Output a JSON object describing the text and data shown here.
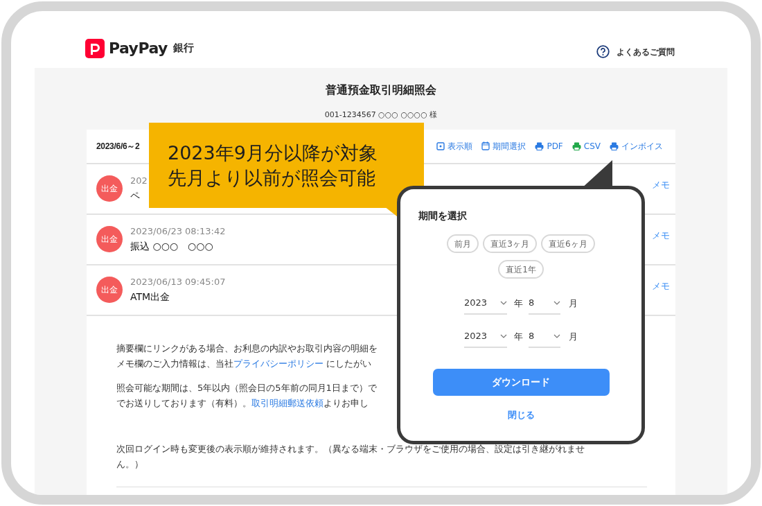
{
  "header": {
    "brand": "PayPay",
    "brand_suffix": "銀行",
    "help_link": "よくあるご質問"
  },
  "page": {
    "title": "普通預金取引明細照会",
    "account": "001-1234567 ○○○ ○○○○ 様"
  },
  "toolbar": {
    "period": "2023/6/6～2",
    "links": [
      {
        "label": "表示順",
        "kind": "sort"
      },
      {
        "label": "期間選択",
        "kind": "calendar"
      },
      {
        "label": "PDF",
        "kind": "print"
      },
      {
        "label": "CSV",
        "kind": "print-green"
      },
      {
        "label": "インボイス",
        "kind": "print"
      }
    ]
  },
  "transactions": [
    {
      "badge": "出金",
      "datetime": "202",
      "description": "ペ",
      "memo": "メモ"
    },
    {
      "badge": "出金",
      "datetime": "2023/06/23 08:13:42",
      "description": "振込 ○○○　○○○",
      "memo": "メモ"
    },
    {
      "badge": "出金",
      "datetime": "2023/06/13 09:45:07",
      "description": "ATM出金",
      "memo": "メモ"
    }
  ],
  "notes": [
    {
      "lines": [
        [
          {
            "kind": "text",
            "text": "摘要欄にリンクがある場合、お利息の内訳やお取引内容の明細を"
          }
        ],
        [
          {
            "kind": "text",
            "text": "メモ欄のご入力情報は、当社"
          },
          {
            "kind": "link",
            "text": "プライバシーポリシー"
          },
          {
            "kind": "text",
            "text": " にしたがい"
          }
        ]
      ]
    },
    {
      "lines": [
        [
          {
            "kind": "text",
            "text": "照会可能な期間は、5年以内（照会日の5年前の同月1日まで）で"
          }
        ],
        [
          {
            "kind": "text",
            "text": "でお送りしております（有料）。"
          },
          {
            "kind": "link",
            "text": "取引明細郵送依頼"
          },
          {
            "kind": "text",
            "text": "よりお申し"
          }
        ]
      ]
    },
    {
      "lines": [
        [
          {
            "kind": "text",
            "text": "次回ログイン時も変更後の表示順が維持されます。（異なる端末・ブラウザをご使用の場合、設定は引き継がれませ"
          }
        ],
        [
          {
            "kind": "text",
            "text": "ん。）"
          }
        ]
      ]
    }
  ],
  "callout": {
    "lines": [
      "2023年9月分以降が対象",
      "先月より以前が照会可能"
    ]
  },
  "popup": {
    "title": "期間を選択",
    "presets": [
      "前月",
      "直近3ヶ月",
      "直近6ヶ月",
      "直近1年"
    ],
    "ranges": [
      {
        "year": "2023",
        "year_unit": "年",
        "month": "8",
        "month_unit": "月"
      },
      {
        "year": "2023",
        "year_unit": "年",
        "month": "8",
        "month_unit": "月"
      }
    ],
    "download": "ダウンロード",
    "close": "閉じる"
  }
}
